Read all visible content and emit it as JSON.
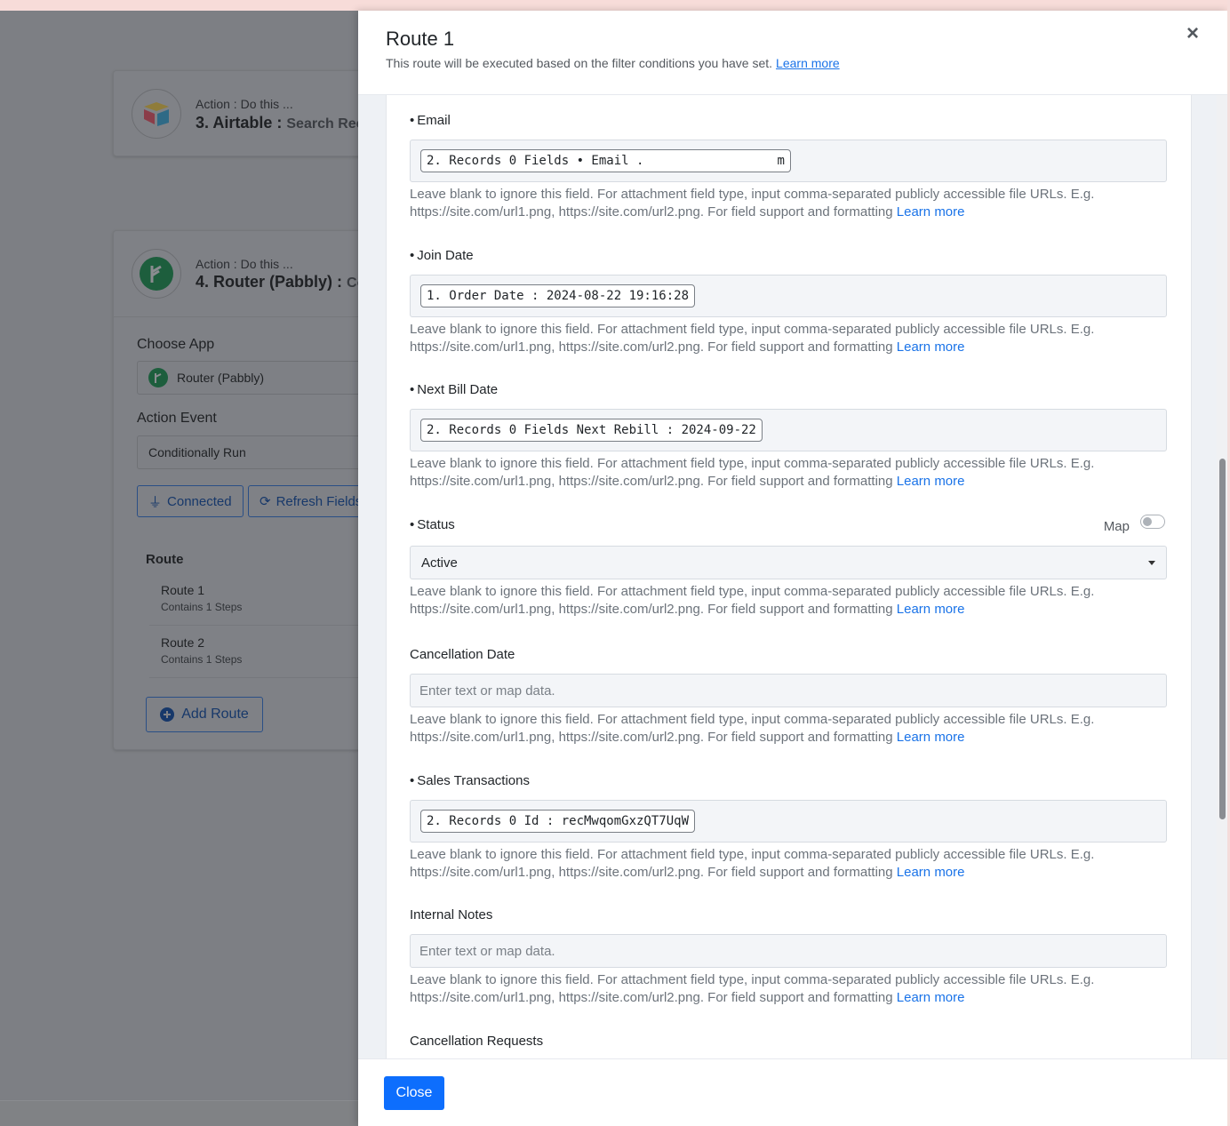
{
  "background": {
    "step3": {
      "action_label": "Action : Do this ...",
      "title": "3. Airtable :",
      "subtitle": "Search Reco"
    },
    "step4": {
      "action_label": "Action : Do this ...",
      "title": "4. Router (Pabbly) :",
      "subtitle": "Co"
    },
    "choose_app_label": "Choose App",
    "choose_app_value": "Router (Pabbly)",
    "action_event_label": "Action Event",
    "action_event_value": "Conditionally Run",
    "connected_label": "Connected",
    "refresh_label": "Refresh Fields",
    "route_heading": "Route",
    "routes": [
      {
        "name": "Route 1",
        "steps": "Contains 1 Steps"
      },
      {
        "name": "Route 2",
        "steps": "Contains 1 Steps"
      }
    ],
    "add_route_label": "Add Route"
  },
  "modal": {
    "title": "Route 1",
    "subtitle": "This route will be executed based on the filter conditions you have set.",
    "learn_more": "Learn more",
    "help_text": "Leave blank to ignore this field. For attachment field type, input comma-separated publicly accessible file URLs. E.g. https://site.com/url1.png, https://site.com/url2.png. For field support and formatting",
    "help_link": "Learn more",
    "placeholder": "Enter text or map data.",
    "fields": {
      "email": {
        "label": "Email",
        "token": "2. Records 0 Fields • Email .",
        "token_tail": "m"
      },
      "join_date": {
        "label": "Join Date",
        "token": "1. Order Date : 2024-08-22 19:16:28"
      },
      "next_bill": {
        "label": "Next Bill Date",
        "token": "2. Records 0 Fields Next Rebill : 2024-09-22"
      },
      "status": {
        "label": "Status",
        "value": "Active",
        "map_label": "Map"
      },
      "cancellation_date": {
        "label": "Cancellation Date"
      },
      "sales_transactions": {
        "label": "Sales Transactions",
        "token": "2. Records 0 Id : recMwqomGxzQT7UqW"
      },
      "internal_notes": {
        "label": "Internal Notes"
      },
      "cancellation_requests": {
        "label": "Cancellation Requests"
      }
    },
    "close_label": "Close"
  },
  "colors": {
    "primary": "#0d6efd",
    "link": "#1a73e8"
  }
}
